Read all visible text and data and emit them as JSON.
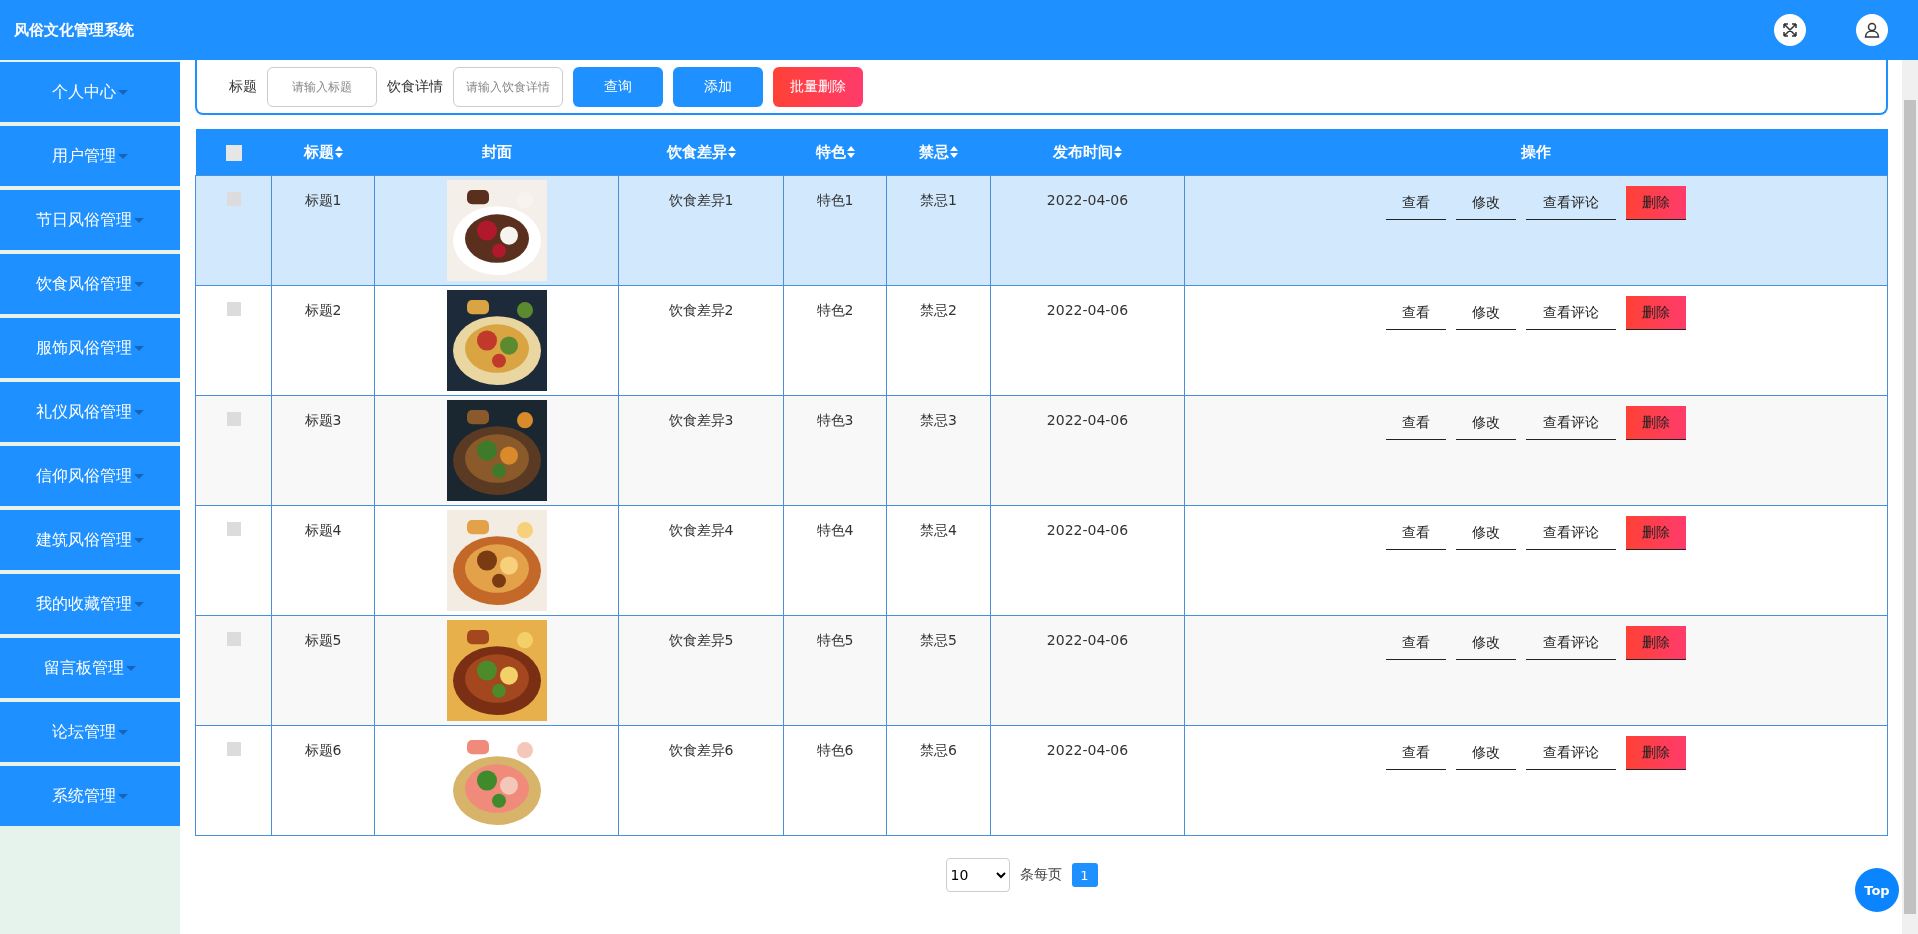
{
  "header": {
    "title": "风俗文化管理系统"
  },
  "sidebar": {
    "items": [
      {
        "label": "个人中心"
      },
      {
        "label": "用户管理"
      },
      {
        "label": "节日风俗管理"
      },
      {
        "label": "饮食风俗管理"
      },
      {
        "label": "服饰风俗管理"
      },
      {
        "label": "礼仪风俗管理"
      },
      {
        "label": "信仰风俗管理"
      },
      {
        "label": "建筑风俗管理"
      },
      {
        "label": "我的收藏管理"
      },
      {
        "label": "留言板管理"
      },
      {
        "label": "论坛管理"
      },
      {
        "label": "系统管理"
      }
    ]
  },
  "search": {
    "fields": [
      {
        "label": "标题",
        "placeholder": "请输入标题"
      },
      {
        "label": "饮食详情",
        "placeholder": "请输入饮食详情"
      }
    ],
    "buttons": [
      {
        "label": "查询",
        "kind": "primary"
      },
      {
        "label": "添加",
        "kind": "primary"
      },
      {
        "label": "批量删除",
        "kind": "danger"
      }
    ]
  },
  "table": {
    "select_all": {
      "checked": false
    },
    "columns": [
      {
        "label": "标题",
        "sortable": true
      },
      {
        "label": "封面",
        "sortable": false
      },
      {
        "label": "饮食差异",
        "sortable": true
      },
      {
        "label": "特色",
        "sortable": true
      },
      {
        "label": "禁忌",
        "sortable": true
      },
      {
        "label": "发布时间",
        "sortable": true
      },
      {
        "label": "操作",
        "sortable": false
      }
    ],
    "rows": [
      {
        "checked": false,
        "selected": true,
        "title": "标题1",
        "difference": "饮食差异1",
        "feature": "特色1",
        "taboo": "禁忌1",
        "date": "2022-04-06",
        "actions": [
          {
            "label": "查看",
            "kind": "link"
          },
          {
            "label": "修改",
            "kind": "link"
          },
          {
            "label": "查看评论",
            "kind": "link"
          },
          {
            "label": "删除",
            "kind": "danger"
          }
        ]
      },
      {
        "checked": false,
        "selected": false,
        "title": "标题2",
        "difference": "饮食差异2",
        "feature": "特色2",
        "taboo": "禁忌2",
        "date": "2022-04-06",
        "actions": [
          {
            "label": "查看",
            "kind": "link"
          },
          {
            "label": "修改",
            "kind": "link"
          },
          {
            "label": "查看评论",
            "kind": "link"
          },
          {
            "label": "删除",
            "kind": "danger"
          }
        ]
      },
      {
        "checked": false,
        "selected": false,
        "title": "标题3",
        "difference": "饮食差异3",
        "feature": "特色3",
        "taboo": "禁忌3",
        "date": "2022-04-06",
        "actions": [
          {
            "label": "查看",
            "kind": "link"
          },
          {
            "label": "修改",
            "kind": "link"
          },
          {
            "label": "查看评论",
            "kind": "link"
          },
          {
            "label": "删除",
            "kind": "danger"
          }
        ]
      },
      {
        "checked": false,
        "selected": false,
        "title": "标题4",
        "difference": "饮食差异4",
        "feature": "特色4",
        "taboo": "禁忌4",
        "date": "2022-04-06",
        "actions": [
          {
            "label": "查看",
            "kind": "link"
          },
          {
            "label": "修改",
            "kind": "link"
          },
          {
            "label": "查看评论",
            "kind": "link"
          },
          {
            "label": "删除",
            "kind": "danger"
          }
        ]
      },
      {
        "checked": false,
        "selected": false,
        "title": "标题5",
        "difference": "饮食差异5",
        "feature": "特色5",
        "taboo": "禁忌5",
        "date": "2022-04-06",
        "actions": [
          {
            "label": "查看",
            "kind": "link"
          },
          {
            "label": "修改",
            "kind": "link"
          },
          {
            "label": "查看评论",
            "kind": "link"
          },
          {
            "label": "删除",
            "kind": "danger"
          }
        ]
      },
      {
        "checked": false,
        "selected": false,
        "title": "标题6",
        "difference": "饮食差异6",
        "feature": "特色6",
        "taboo": "禁忌6",
        "date": "2022-04-06",
        "actions": [
          {
            "label": "查看",
            "kind": "link"
          },
          {
            "label": "修改",
            "kind": "link"
          },
          {
            "label": "查看评论",
            "kind": "link"
          },
          {
            "label": "删除",
            "kind": "danger"
          }
        ]
      }
    ]
  },
  "pagination": {
    "page_size": "10",
    "per_page_label": "条每页",
    "pages": [
      {
        "label": "1",
        "selected": true
      }
    ]
  },
  "top_button": {
    "label": "Top"
  }
}
